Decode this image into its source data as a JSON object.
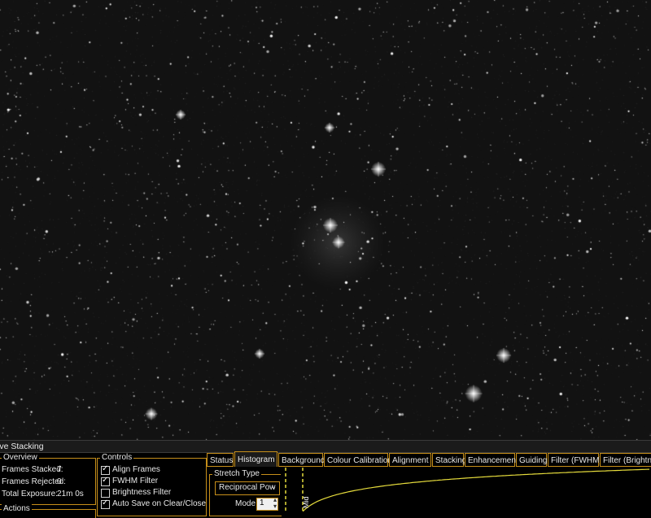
{
  "panel": {
    "title": "ive Stacking",
    "overview": {
      "label": "Overview",
      "frames_stacked_label": "Frames Stacked:",
      "frames_stacked": "7",
      "frames_rejected_label": "Frames Rejected:",
      "frames_rejected": "0",
      "total_exposure_label": "Total Exposure:",
      "total_exposure": "21m 0s"
    },
    "actions": {
      "label": "Actions"
    },
    "controls": {
      "label": "Controls",
      "items": [
        {
          "label": "Align Frames",
          "checked": true
        },
        {
          "label": "FWHM Filter",
          "checked": true
        },
        {
          "label": "Brightness Filter",
          "checked": false
        },
        {
          "label": "Auto Save on Clear/Close",
          "checked": true
        }
      ]
    },
    "tabs": [
      {
        "label": "Status",
        "active": false
      },
      {
        "label": "Histogram",
        "active": true
      },
      {
        "label": "Background",
        "active": false
      },
      {
        "label": "Colour Calibration",
        "active": false
      },
      {
        "label": "Alignment",
        "active": false
      },
      {
        "label": "Stacking",
        "active": false
      },
      {
        "label": "Enhancement",
        "active": false
      },
      {
        "label": "Guiding",
        "active": false
      },
      {
        "label": "Filter (FWHM)",
        "active": false
      },
      {
        "label": "Filter (Brightness",
        "active": false
      }
    ],
    "stretch": {
      "label": "Stretch Type",
      "selected": "Reciprocal Pow",
      "mode_label": "Mode",
      "mode_value": "1"
    },
    "histogram": {
      "mid_label": "Mid",
      "curve_color": "#e6dc3c",
      "marker_color": "#e6dc3c"
    }
  },
  "colors": {
    "accent": "#c78f1a",
    "background": "#000000"
  }
}
